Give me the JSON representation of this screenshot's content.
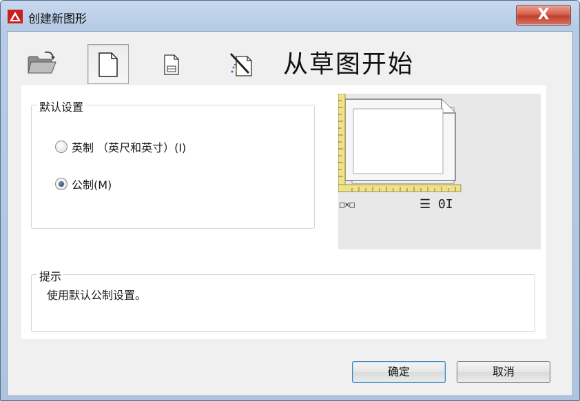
{
  "window": {
    "title": "创建新图形",
    "close_glyph": "X"
  },
  "toolbar": {
    "heading": "从草图开始",
    "buttons": [
      {
        "id": "open",
        "icon": "open-folder-icon"
      },
      {
        "id": "start-from-scratch",
        "icon": "blank-page-icon",
        "selected": true
      },
      {
        "id": "use-template",
        "icon": "template-page-icon"
      },
      {
        "id": "use-wizard",
        "icon": "wizard-icon"
      }
    ]
  },
  "default_settings": {
    "legend": "默认设置",
    "options": [
      {
        "label": "英制 （英尺和英寸）(I)",
        "checked": false
      },
      {
        "label": "公制(M)",
        "checked": true
      }
    ]
  },
  "preview": {
    "width_field": "□×□",
    "height_field": "☰ 0I"
  },
  "hint": {
    "legend": "提示",
    "text": "使用默认公制设置。"
  },
  "buttons": {
    "ok": "确定",
    "cancel": "取消"
  },
  "colors": {
    "app_icon": "#c8201e",
    "close_button": "#c23f2a",
    "ruler": "#f0e28a",
    "ok_border": "#3c7fb1"
  }
}
